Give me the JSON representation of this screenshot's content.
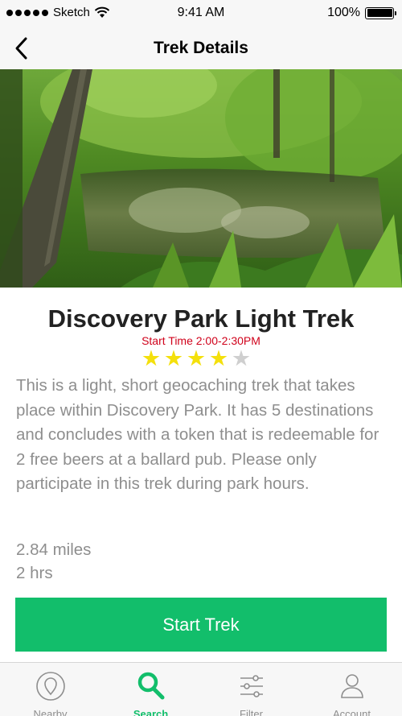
{
  "status_bar": {
    "carrier": "Sketch",
    "time": "9:41 AM",
    "battery": "100%"
  },
  "nav": {
    "title": "Trek Details",
    "back_icon": "chevron-left-icon"
  },
  "trek": {
    "title": "Discovery Park Light Trek",
    "start_time": "Start Time 2:00-2:30PM",
    "rating": 4,
    "rating_max": 5,
    "description": "This is a light, short geocaching trek that takes place within Discovery Park. It has 5 destinations and concludes with a token that is redeemable for 2 free beers at a ballard pub. Please only participate in this trek during park hours.",
    "distance": "2.84 miles",
    "duration": "2 hrs"
  },
  "actions": {
    "start_label": "Start Trek"
  },
  "tabs": [
    {
      "label": "Nearby",
      "icon": "map-pin-icon",
      "active": false
    },
    {
      "label": "Search",
      "icon": "search-icon",
      "active": true
    },
    {
      "label": "Filter",
      "icon": "sliders-icon",
      "active": false
    },
    {
      "label": "Account",
      "icon": "user-icon",
      "active": false
    }
  ],
  "colors": {
    "accent": "#12be6b",
    "start_time": "#d0021b",
    "star_on": "#f4e00c",
    "star_off": "#cfcfcf",
    "text_muted": "#8e8e8e"
  }
}
